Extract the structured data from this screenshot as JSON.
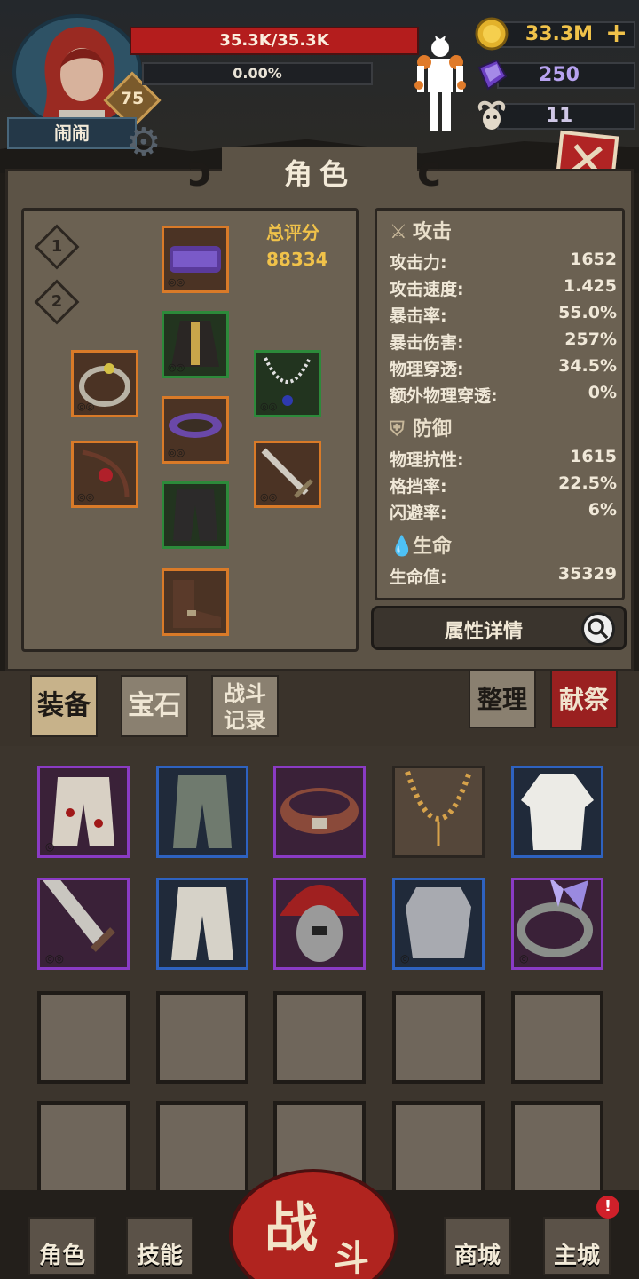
{
  "player": {
    "name": "闹闹",
    "level": "75",
    "hp_text": "35.3K/35.3K",
    "xp_text": "0.00%"
  },
  "resources": {
    "gold": "33.3M",
    "gold_plus": "+",
    "crystal": "250",
    "skull": "11"
  },
  "panel": {
    "title": "角色",
    "loadouts": [
      "1",
      "2"
    ],
    "score_label": "总评分",
    "score_value": "88334"
  },
  "stats": {
    "attack": {
      "header": "攻击",
      "rows": [
        {
          "k": "攻击力:",
          "v": "1652"
        },
        {
          "k": "攻击速度:",
          "v": "1.425"
        },
        {
          "k": "暴击率:",
          "v": "55.0%"
        },
        {
          "k": "暴击伤害:",
          "v": "257%"
        },
        {
          "k": "物理穿透:",
          "v": "34.5%"
        },
        {
          "k": "额外物理穿透:",
          "v": "0%"
        }
      ]
    },
    "defense": {
      "header": "防御",
      "rows": [
        {
          "k": "物理抗性:",
          "v": "1615"
        },
        {
          "k": "格挡率:",
          "v": "22.5%"
        },
        {
          "k": "闪避率:",
          "v": "6%"
        }
      ]
    },
    "life": {
      "header": "生命",
      "rows": [
        {
          "k": "生命值:",
          "v": "35329"
        }
      ]
    },
    "detail_button": "属性详情"
  },
  "tabs": {
    "equip": "装备",
    "gem": "宝石",
    "battle_log_1": "战斗",
    "battle_log_2": "记录",
    "sort": "整理",
    "sacrifice": "献祭"
  },
  "inventory": {
    "rows": [
      [
        {
          "item": "bloody-trousers",
          "rarity": "purple"
        },
        {
          "item": "green-trousers",
          "rarity": "blue"
        },
        {
          "item": "leather-belt",
          "rarity": "purple"
        },
        {
          "item": "bead-necklace",
          "rarity": "brown"
        },
        {
          "item": "white-robe",
          "rarity": "blue"
        }
      ],
      [
        {
          "item": "broad-sword",
          "rarity": "purple"
        },
        {
          "item": "white-trousers",
          "rarity": "blue"
        },
        {
          "item": "plumed-helmet",
          "rarity": "purple"
        },
        {
          "item": "scale-armor",
          "rarity": "blue"
        },
        {
          "item": "butterfly-ring",
          "rarity": "purple"
        }
      ]
    ],
    "empty_rows": 2
  },
  "nav": {
    "character": "角色",
    "skills": "技能",
    "battle_1": "战",
    "battle_2": "斗",
    "shop": "商城",
    "castle": "主城",
    "castle_alert": "!"
  },
  "colors": {
    "hp_red": "#b41d1d",
    "gold": "#f0c24a",
    "crystal": "#b7a2f0",
    "rarity_purple": "#8a3bc4",
    "rarity_blue": "#2e62c0",
    "rarity_orange": "#d97a28",
    "rarity_green": "#2c8a3a"
  }
}
